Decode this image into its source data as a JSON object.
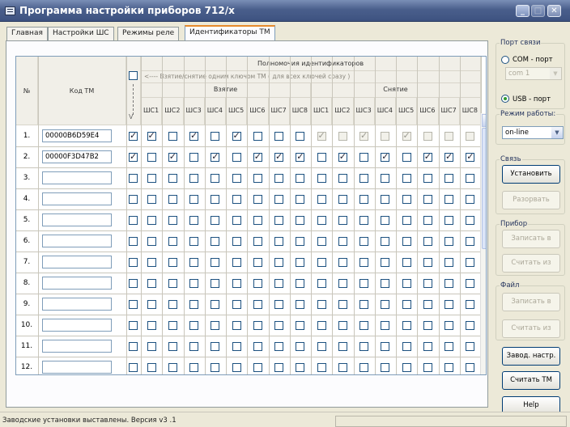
{
  "window": {
    "title": "Программа настройки приборов 712/x"
  },
  "tabs": [
    "Главная",
    "Настройки ШС",
    "Режимы реле",
    "Идентификаторы ТМ"
  ],
  "active_tab": 3,
  "table": {
    "num_header": "№",
    "code_header": "Код ТМ",
    "rights_header": "Полномочия идентификаторов",
    "same_key_label": "<---- Взятие/снятие одним ключом ТМ ( для всех ключей сразу )",
    "arm_header": "Взятие",
    "disarm_header": "Снятие",
    "zones": [
      "ШС1",
      "ШС2",
      "ШС3",
      "ШС4",
      "ШС5",
      "ШС6",
      "ШС7",
      "ШС8"
    ],
    "same_key_checked": false,
    "rows": [
      {
        "n": "1.",
        "code": "00000B6D59E4",
        "same": true,
        "arm": [
          true,
          false,
          true,
          false,
          true,
          false,
          false,
          false
        ],
        "disarm": [
          true,
          false,
          true,
          false,
          true,
          false,
          false,
          false
        ],
        "disarm_disabled": true
      },
      {
        "n": "2.",
        "code": "00000F3D47B2",
        "same": true,
        "arm": [
          false,
          true,
          false,
          true,
          false,
          true,
          true,
          true
        ],
        "disarm": [
          false,
          true,
          false,
          true,
          false,
          true,
          true,
          true
        ],
        "disarm_disabled": false
      },
      {
        "n": "3.",
        "code": "",
        "same": false,
        "arm": [
          false,
          false,
          false,
          false,
          false,
          false,
          false,
          false
        ],
        "disarm": [
          false,
          false,
          false,
          false,
          false,
          false,
          false,
          false
        ],
        "disarm_disabled": false
      },
      {
        "n": "4.",
        "code": "",
        "same": false,
        "arm": [
          false,
          false,
          false,
          false,
          false,
          false,
          false,
          false
        ],
        "disarm": [
          false,
          false,
          false,
          false,
          false,
          false,
          false,
          false
        ],
        "disarm_disabled": false
      },
      {
        "n": "5.",
        "code": "",
        "same": false,
        "arm": [
          false,
          false,
          false,
          false,
          false,
          false,
          false,
          false
        ],
        "disarm": [
          false,
          false,
          false,
          false,
          false,
          false,
          false,
          false
        ],
        "disarm_disabled": false
      },
      {
        "n": "6.",
        "code": "",
        "same": false,
        "arm": [
          false,
          false,
          false,
          false,
          false,
          false,
          false,
          false
        ],
        "disarm": [
          false,
          false,
          false,
          false,
          false,
          false,
          false,
          false
        ],
        "disarm_disabled": false
      },
      {
        "n": "7.",
        "code": "",
        "same": false,
        "arm": [
          false,
          false,
          false,
          false,
          false,
          false,
          false,
          false
        ],
        "disarm": [
          false,
          false,
          false,
          false,
          false,
          false,
          false,
          false
        ],
        "disarm_disabled": false
      },
      {
        "n": "8.",
        "code": "",
        "same": false,
        "arm": [
          false,
          false,
          false,
          false,
          false,
          false,
          false,
          false
        ],
        "disarm": [
          false,
          false,
          false,
          false,
          false,
          false,
          false,
          false
        ],
        "disarm_disabled": false
      },
      {
        "n": "9.",
        "code": "",
        "same": false,
        "arm": [
          false,
          false,
          false,
          false,
          false,
          false,
          false,
          false
        ],
        "disarm": [
          false,
          false,
          false,
          false,
          false,
          false,
          false,
          false
        ],
        "disarm_disabled": false
      },
      {
        "n": "10.",
        "code": "",
        "same": false,
        "arm": [
          false,
          false,
          false,
          false,
          false,
          false,
          false,
          false
        ],
        "disarm": [
          false,
          false,
          false,
          false,
          false,
          false,
          false,
          false
        ],
        "disarm_disabled": false
      },
      {
        "n": "11.",
        "code": "",
        "same": false,
        "arm": [
          false,
          false,
          false,
          false,
          false,
          false,
          false,
          false
        ],
        "disarm": [
          false,
          false,
          false,
          false,
          false,
          false,
          false,
          false
        ],
        "disarm_disabled": false
      },
      {
        "n": "12.",
        "code": "",
        "same": false,
        "arm": [
          false,
          false,
          false,
          false,
          false,
          false,
          false,
          false
        ],
        "disarm": [
          false,
          false,
          false,
          false,
          false,
          false,
          false,
          false
        ],
        "disarm_disabled": false
      }
    ]
  },
  "side": {
    "port_label": "Порт связи",
    "com_label": "COM - порт",
    "com_value": "com 1",
    "usb_label": "USB - порт",
    "port_selected": "usb",
    "mode_label": "Режим работы:",
    "mode_value": "on-line",
    "link_label": "Связь",
    "connect_button": "Установить",
    "disconnect_button": "Разорвать",
    "device_label": "Прибор",
    "device_write_button": "Записать в",
    "device_read_button": "Считать из",
    "file_label": "Файл",
    "file_write_button": "Записать в",
    "file_read_button": "Считать из",
    "factory_button": "Завод. настр.",
    "read_tm_button": "Считать ТМ",
    "help_button": "Help"
  },
  "status_text": "Заводские установки выставлены. Версия v3 .1"
}
